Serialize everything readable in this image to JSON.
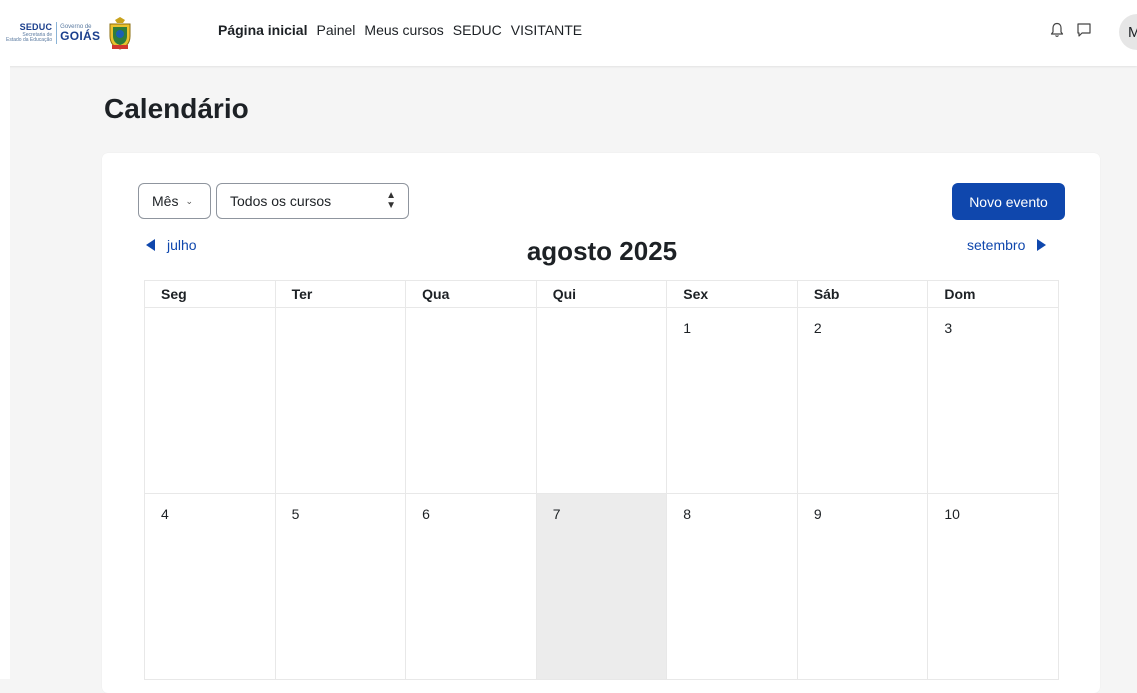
{
  "brand": {
    "seduc": "SEDUC",
    "seduc_sub1": "Secretaria de",
    "seduc_sub2": "Estado da Educação",
    "goias_top": "Governo de",
    "goias": "GOIÁS"
  },
  "nav": {
    "items": [
      {
        "label": "Página inicial",
        "active": true
      },
      {
        "label": "Painel",
        "active": false
      },
      {
        "label": "Meus cursos",
        "active": false
      },
      {
        "label": "SEDUC",
        "active": false
      },
      {
        "label": "VISITANTE",
        "active": false
      }
    ],
    "icons": [
      "bell-icon",
      "chat-icon"
    ],
    "avatar_initial": "M"
  },
  "page": {
    "title": "Calendário"
  },
  "controls": {
    "view_select": "Mês",
    "course_select": "Todos os cursos",
    "new_event_label": "Novo evento"
  },
  "calendar": {
    "prev_month": "julho",
    "next_month": "setembro",
    "current_month": "agosto 2025",
    "weekdays": [
      "Seg",
      "Ter",
      "Qua",
      "Qui",
      "Sex",
      "Sáb",
      "Dom"
    ],
    "weeks": [
      [
        "",
        "",
        "",
        "",
        "1",
        "2",
        "3"
      ],
      [
        "4",
        "5",
        "6",
        "7",
        "8",
        "9",
        "10"
      ]
    ],
    "today": "7"
  },
  "colors": {
    "accent": "#0f47ad",
    "today_bg": "#ececec",
    "page_bg": "#f5f5f5"
  }
}
